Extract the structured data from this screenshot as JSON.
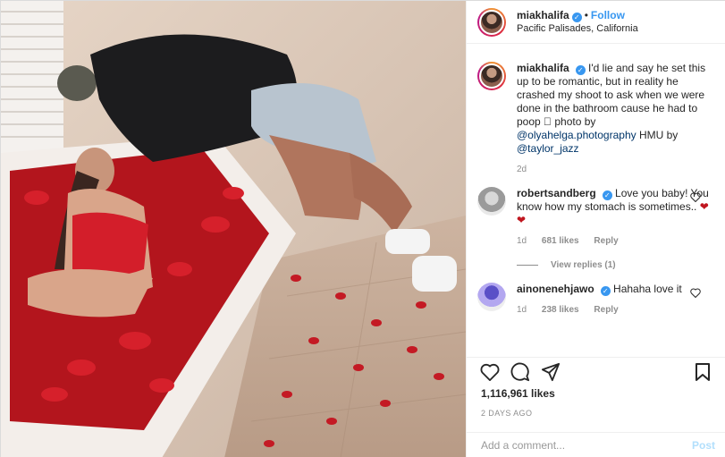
{
  "post": {
    "author": "miakhalifa",
    "follow_label": "Follow",
    "dot": "•",
    "verified_glyph": "✓",
    "location": "Pacific Palisades, California",
    "photo_desc": "photo",
    "caption": {
      "text_before": "I'd lie and say he set this up to be romantic, but in reality he crashed my shoot to ask when we were done in the bathroom cause he had to poop \u0000 photo by ",
      "mention1": "@olyahelga.photography",
      "mid": " HMU by ",
      "mention2": "@taylor_jazz",
      "age": "2d"
    },
    "comments": [
      {
        "user": "robertsandberg",
        "text": "Love you baby! You know how my stomach is sometimes..",
        "emoji": "❤❤",
        "age": "1d",
        "likes": "681 likes",
        "reply": "Reply",
        "view_replies": "View replies (1)"
      },
      {
        "user": "ainonenehjawo",
        "text": "Hahaha love it",
        "age": "1d",
        "likes": "238 likes",
        "reply": "Reply"
      }
    ],
    "likes_count": "1,116,961 likes",
    "posted_ago": "2 DAYS AGO",
    "add_comment_placeholder": "Add a comment...",
    "post_label": "Post"
  },
  "icons": {
    "like": "heart-icon",
    "comment": "comment-icon",
    "share": "share-icon",
    "save": "bookmark-icon",
    "comment_like": "heart-icon"
  },
  "colors": {
    "accent": "#3897f0",
    "post_disabled": "#b2dffc",
    "muted": "#8e8e8e",
    "mention": "#003569"
  }
}
